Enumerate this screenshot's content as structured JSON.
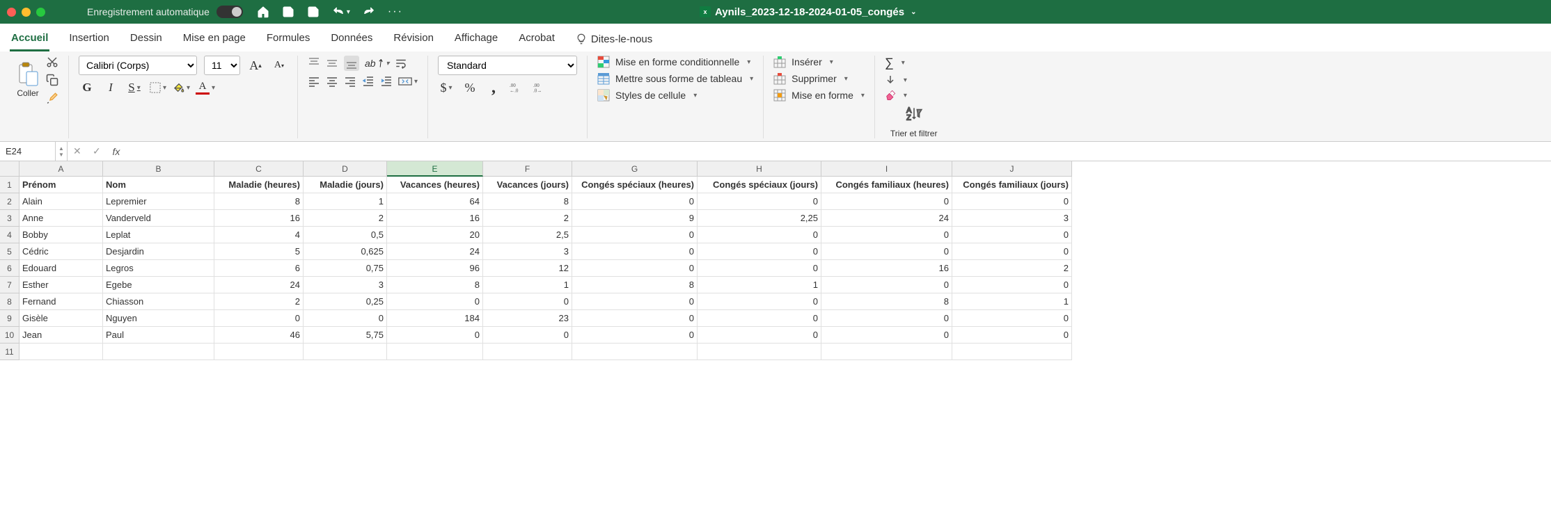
{
  "titleBar": {
    "autosave": "Enregistrement automatique",
    "docName": "Aynils_2023-12-18-2024-01-05_congés"
  },
  "ribbonTabs": [
    "Accueil",
    "Insertion",
    "Dessin",
    "Mise en page",
    "Formules",
    "Données",
    "Révision",
    "Affichage",
    "Acrobat"
  ],
  "tellMe": "Dites-le-nous",
  "ribbon": {
    "pasteLabel": "Coller",
    "fontName": "Calibri (Corps)",
    "fontSize": "11",
    "numberFormat": "Standard",
    "condFormat": "Mise en forme conditionnelle",
    "tableFormat": "Mettre sous forme de tableau",
    "cellStyles": "Styles de cellule",
    "insert": "Insérer",
    "delete": "Supprimer",
    "format": "Mise en forme",
    "sortFilter": "Trier et filtrer"
  },
  "formulaBar": {
    "nameBox": "E24",
    "formula": ""
  },
  "sheet": {
    "columns": [
      "A",
      "B",
      "C",
      "D",
      "E",
      "F",
      "G",
      "H",
      "I",
      "J"
    ],
    "activeCol": "E",
    "headers": [
      "Prénom",
      "Nom",
      "Maladie (heures)",
      "Maladie (jours)",
      "Vacances (heures)",
      "Vacances (jours)",
      "Congés spéciaux (heures)",
      "Congés spéciaux (jours)",
      "Congés familiaux (heures)",
      "Congés familiaux (jours)"
    ],
    "rows": [
      {
        "prenom": "Alain",
        "nom": "Lepremier",
        "mh": "8",
        "mj": "1",
        "vh": "64",
        "vj": "8",
        "csh": "0",
        "csj": "0",
        "cfh": "0",
        "cfj": "0"
      },
      {
        "prenom": "Anne",
        "nom": "Vanderveld",
        "mh": "16",
        "mj": "2",
        "vh": "16",
        "vj": "2",
        "csh": "9",
        "csj": "2,25",
        "cfh": "24",
        "cfj": "3"
      },
      {
        "prenom": "Bobby",
        "nom": "Leplat",
        "mh": "4",
        "mj": "0,5",
        "vh": "20",
        "vj": "2,5",
        "csh": "0",
        "csj": "0",
        "cfh": "0",
        "cfj": "0"
      },
      {
        "prenom": "Cédric",
        "nom": "Desjardin",
        "mh": "5",
        "mj": "0,625",
        "vh": "24",
        "vj": "3",
        "csh": "0",
        "csj": "0",
        "cfh": "0",
        "cfj": "0"
      },
      {
        "prenom": "Edouard",
        "nom": "Legros",
        "mh": "6",
        "mj": "0,75",
        "vh": "96",
        "vj": "12",
        "csh": "0",
        "csj": "0",
        "cfh": "16",
        "cfj": "2"
      },
      {
        "prenom": "Esther",
        "nom": "Egebe",
        "mh": "24",
        "mj": "3",
        "vh": "8",
        "vj": "1",
        "csh": "8",
        "csj": "1",
        "cfh": "0",
        "cfj": "0"
      },
      {
        "prenom": "Fernand",
        "nom": "Chiasson",
        "mh": "2",
        "mj": "0,25",
        "vh": "0",
        "vj": "0",
        "csh": "0",
        "csj": "0",
        "cfh": "8",
        "cfj": "1"
      },
      {
        "prenom": "Gisèle",
        "nom": "Nguyen",
        "mh": "0",
        "mj": "0",
        "vh": "184",
        "vj": "23",
        "csh": "0",
        "csj": "0",
        "cfh": "0",
        "cfj": "0"
      },
      {
        "prenom": "Jean",
        "nom": "Paul",
        "mh": "46",
        "mj": "5,75",
        "vh": "0",
        "vj": "0",
        "csh": "0",
        "csj": "0",
        "cfh": "0",
        "cfj": "0"
      }
    ]
  }
}
